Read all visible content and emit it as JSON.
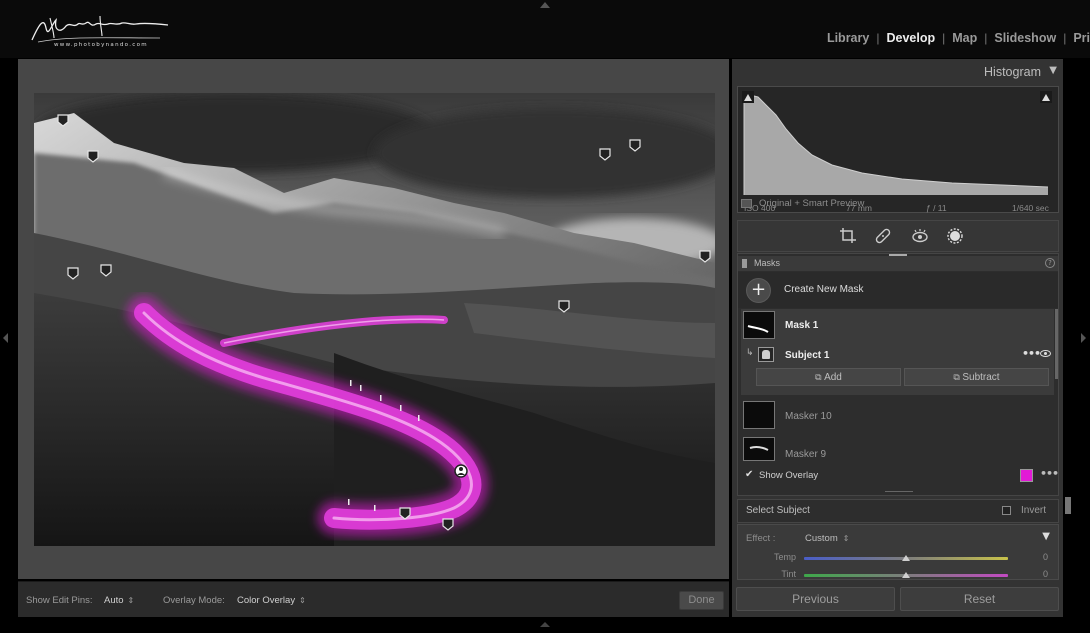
{
  "app": {
    "logo_url_text": "www.photobynando.com",
    "modules": [
      {
        "label": "Library",
        "active": false
      },
      {
        "label": "Develop",
        "active": true
      },
      {
        "label": "Map",
        "active": false
      },
      {
        "label": "Slideshow",
        "active": false
      },
      {
        "label": "Pri",
        "active": false
      }
    ]
  },
  "toolbar": {
    "show_edit_pins_label": "Show Edit Pins:",
    "show_edit_pins_value": "Auto",
    "overlay_mode_label": "Overlay Mode:",
    "overlay_mode_value": "Color Overlay",
    "done_label": "Done"
  },
  "histogram": {
    "title": "Histogram",
    "iso": "ISO 400",
    "focal_length": "77 mm",
    "aperture": "ƒ / 11",
    "shutter": "1/640 sec",
    "preview_label": "Original + Smart Preview"
  },
  "masks": {
    "title": "Masks",
    "create_label": "Create New Mask",
    "mask1_label": "Mask 1",
    "subject1_label": "Subject 1",
    "add_label": "Add",
    "subtract_label": "Subtract",
    "masker10_label": "Masker 10",
    "masker9_label": "Masker 9",
    "show_overlay_label": "Show Overlay",
    "overlay_color": "#e21ad6",
    "show_overlay_checked": true
  },
  "subject": {
    "label": "Select Subject",
    "invert_label": "Invert"
  },
  "effect": {
    "label": "Effect :",
    "value": "Custom",
    "sliders": [
      {
        "label": "Temp",
        "value": "0"
      },
      {
        "label": "Tint",
        "value": "0"
      }
    ]
  },
  "buttons": {
    "previous_label": "Previous",
    "reset_label": "Reset"
  },
  "colors": {
    "accent_overlay": "#e21ad6",
    "panel_bg": "#333333",
    "app_bg": "#000000"
  }
}
